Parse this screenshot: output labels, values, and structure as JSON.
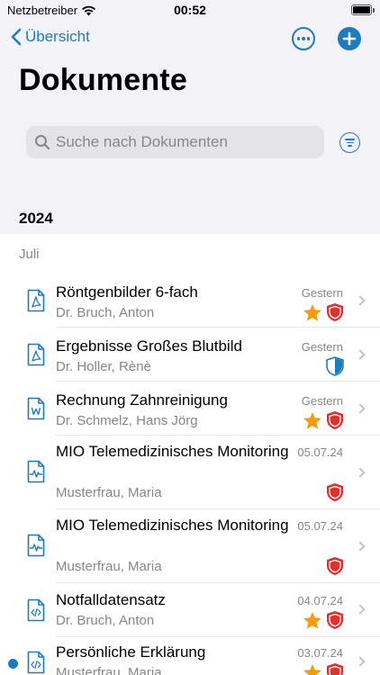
{
  "status": {
    "carrier": "Netzbetreiber",
    "time": "00:52"
  },
  "nav": {
    "back_label": "Übersicht"
  },
  "page_title": "Dokumente",
  "search": {
    "placeholder": "Suche nach Dokumenten"
  },
  "year": "2024",
  "month": "Juli",
  "colors": {
    "accent": "#1f7bbf",
    "star": "#f39c12",
    "shield_red": "#e03131",
    "shield_blue": "#1f7bbf"
  },
  "documents": [
    {
      "title": "Röntgenbilder 6-fach",
      "author": "Dr. Bruch, Anton",
      "date": "Gestern",
      "icon": "pdf-icon",
      "star": true,
      "shield": "red",
      "unread": false
    },
    {
      "title": "Ergebnisse Großes Blutbild",
      "author": "Dr. Holler, Rènè",
      "date": "Gestern",
      "icon": "pdf-icon",
      "star": false,
      "shield": "blue",
      "unread": false
    },
    {
      "title": "Rechnung Zahnreinigung",
      "author": "Dr. Schmelz, Hans Jörg",
      "date": "Gestern",
      "icon": "word-icon",
      "star": true,
      "shield": "red",
      "unread": false
    },
    {
      "title": "MIO Telemedizinisches Monitoring",
      "author": "Musterfrau, Maria",
      "date": "05.07.24",
      "icon": "pulse-icon",
      "star": false,
      "shield": "red",
      "unread": false
    },
    {
      "title": "MIO Telemedizinisches Monitoring",
      "author": "Musterfrau, Maria",
      "date": "05.07.24",
      "icon": "pulse-icon",
      "star": false,
      "shield": "red",
      "unread": false
    },
    {
      "title": "Notfalldatensatz",
      "author": "Dr. Bruch, Anton",
      "date": "04.07.24",
      "icon": "code-icon",
      "star": true,
      "shield": "red",
      "unread": false
    },
    {
      "title": "Persönliche Erklärung",
      "author": "Musterfrau, Maria",
      "date": "03.07.24",
      "icon": "code-icon",
      "star": true,
      "shield": "red",
      "unread": true
    }
  ]
}
